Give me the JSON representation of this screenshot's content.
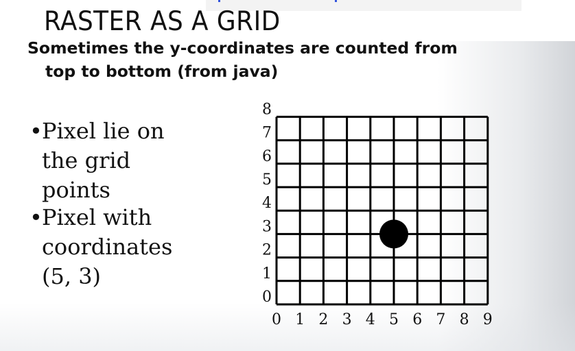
{
  "slide": {
    "title": "RASTER AS A GRID",
    "subtitle_line1": "Sometimes the y-coordinates are counted from",
    "subtitle_line2": "top to bottom (from java)"
  },
  "bullets": [
    {
      "marker": "•",
      "text": "Pixel lie on the grid points"
    },
    {
      "marker": "•",
      "text": "Pixel with coordinates (5, 3)"
    }
  ],
  "bullet_lines": [
    [
      "Pixel lie on",
      "the grid",
      "points"
    ],
    [
      "Pixel with",
      "coordinates",
      "(5, 3)"
    ]
  ],
  "diagram": {
    "x_labels": [
      "0",
      "1",
      "2",
      "3",
      "4",
      "5",
      "6",
      "7",
      "8",
      "9"
    ],
    "y_labels": [
      "0",
      "1",
      "2",
      "3",
      "4",
      "5",
      "6",
      "7",
      "8"
    ],
    "pixel": {
      "x": 5,
      "y": 3
    },
    "colors": {
      "grid": "#000000",
      "pixel": "#000000"
    }
  }
}
